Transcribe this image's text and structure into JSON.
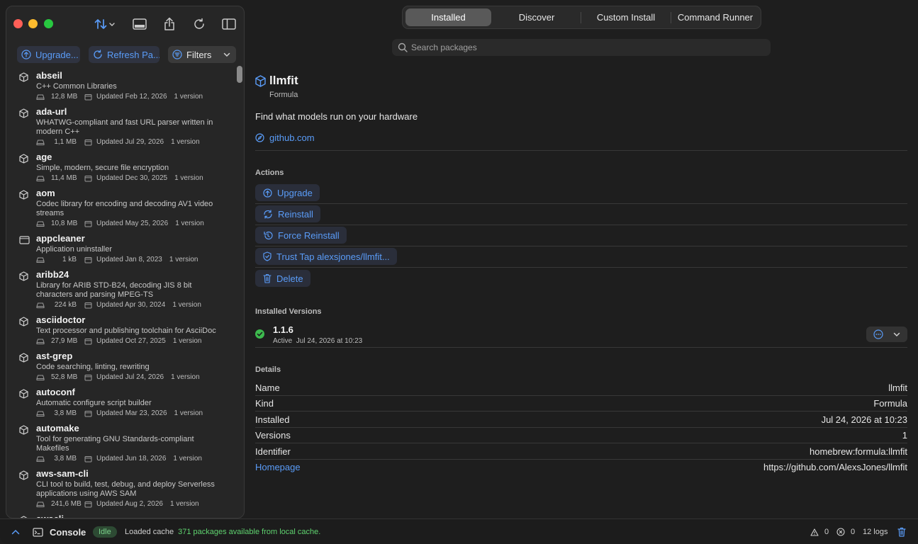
{
  "toolbar": {
    "upgrade_label": "Upgrade...",
    "refresh_label": "Refresh Pa...",
    "filters_label": "Filters"
  },
  "packages": [
    {
      "name": "abseil",
      "desc": "C++ Common Libraries",
      "size": "12,8 MB",
      "updated": "Updated Feb 12, 2026",
      "versions": "1 version",
      "icon": "package-icon"
    },
    {
      "name": "ada-url",
      "desc": "WHATWG-compliant and fast URL parser written in modern C++",
      "size": "1,1 MB",
      "updated": "Updated Jul 29, 2026",
      "versions": "1 version",
      "icon": "package-icon"
    },
    {
      "name": "age",
      "desc": "Simple, modern, secure file encryption",
      "size": "11,4 MB",
      "updated": "Updated Dec 30, 2025",
      "versions": "1 version",
      "icon": "package-icon"
    },
    {
      "name": "aom",
      "desc": "Codec library for encoding and decoding AV1 video streams",
      "size": "10,8 MB",
      "updated": "Updated May 25, 2026",
      "versions": "1 version",
      "icon": "package-icon"
    },
    {
      "name": "appcleaner",
      "desc": "Application uninstaller",
      "size": "1 kB",
      "updated": "Updated Jan 8, 2023",
      "versions": "1 version",
      "icon": "app-window-icon"
    },
    {
      "name": "aribb24",
      "desc": "Library for ARIB STD-B24, decoding JIS 8 bit characters and parsing MPEG-TS",
      "size": "224 kB",
      "updated": "Updated Apr 30, 2024",
      "versions": "1 version",
      "icon": "package-icon"
    },
    {
      "name": "asciidoctor",
      "desc": "Text processor and publishing toolchain for AsciiDoc",
      "size": "27,9 MB",
      "updated": "Updated Oct 27, 2025",
      "versions": "1 version",
      "icon": "package-icon"
    },
    {
      "name": "ast-grep",
      "desc": "Code searching, linting, rewriting",
      "size": "52,8 MB",
      "updated": "Updated Jul 24, 2026",
      "versions": "1 version",
      "icon": "package-icon"
    },
    {
      "name": "autoconf",
      "desc": "Automatic configure script builder",
      "size": "3,8 MB",
      "updated": "Updated Mar 23, 2026",
      "versions": "1 version",
      "icon": "package-icon"
    },
    {
      "name": "automake",
      "desc": "Tool for generating GNU Standards-compliant Makefiles",
      "size": "3,8 MB",
      "updated": "Updated Jun 18, 2026",
      "versions": "1 version",
      "icon": "package-icon"
    },
    {
      "name": "aws-sam-cli",
      "desc": "CLI tool to build, test, debug, and deploy Serverless applications using AWS SAM",
      "size": "241,6 MB",
      "updated": "Updated Aug 2, 2026",
      "versions": "1 version",
      "icon": "package-icon"
    },
    {
      "name": "awscli",
      "desc": "",
      "size": "",
      "updated": "",
      "versions": "",
      "icon": "package-icon"
    }
  ],
  "tabs": [
    "Installed",
    "Discover",
    "Custom Install",
    "Command Runner"
  ],
  "search": {
    "placeholder": "Search packages"
  },
  "detail": {
    "name": "llmfit",
    "kind": "Formula",
    "description": "Find what models run on your hardware",
    "link": "github.com",
    "actions_header": "Actions",
    "actions": [
      {
        "label": "Upgrade",
        "icon": "upgrade-icon"
      },
      {
        "label": "Reinstall",
        "icon": "reinstall-icon"
      },
      {
        "label": "Force Reinstall",
        "icon": "force-reinstall-icon"
      },
      {
        "label": "Trust Tap alexsjones/llmfit...",
        "icon": "shield-check-icon"
      },
      {
        "label": "Delete",
        "icon": "trash-icon"
      }
    ],
    "versions_header": "Installed Versions",
    "version": {
      "number": "1.1.6",
      "status": "Active",
      "date": "Jul 24, 2026 at 10:23"
    },
    "details_header": "Details",
    "details": [
      {
        "key": "Name",
        "value": "llmfit"
      },
      {
        "key": "Kind",
        "value": "Formula"
      },
      {
        "key": "Installed",
        "value": "Jul 24, 2026 at 10:23"
      },
      {
        "key": "Versions",
        "value": "1"
      },
      {
        "key": "Identifier",
        "value": "homebrew:formula:llmfit"
      },
      {
        "key": "Homepage",
        "value": "https://github.com/AlexsJones/llmfit"
      }
    ]
  },
  "statusbar": {
    "console_label": "Console",
    "state": "Idle",
    "message_prefix": "Loaded cache",
    "message": "371 packages available from local cache.",
    "warnings": "0",
    "errors": "0",
    "logs": "12 logs"
  },
  "colors": {
    "accent": "#5a9cf8",
    "active": "#3dba4e",
    "close": "#ff5f57",
    "minimize": "#febc2e",
    "zoom": "#28c840"
  }
}
